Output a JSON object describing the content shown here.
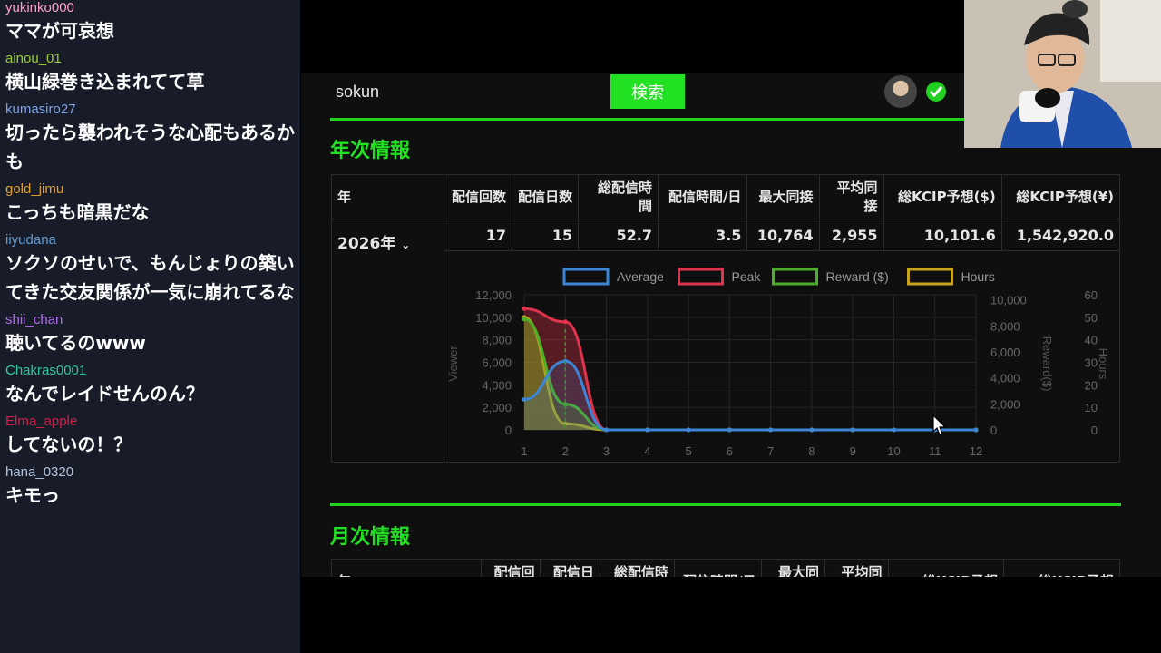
{
  "chat": [
    {
      "user": "yukinko000",
      "color": "#ff9ecf",
      "text": "ママが可哀想"
    },
    {
      "user": "ainou_01",
      "color": "#9acd32",
      "text": "横山緑巻き込まれてて草"
    },
    {
      "user": "kumasiro27",
      "color": "#7ea2e8",
      "text": "切ったら襲われそうな心配もあるかも"
    },
    {
      "user": "gold_jimu",
      "color": "#e0a030",
      "text": "こっちも暗黒だな"
    },
    {
      "user": "iiyudana",
      "color": "#5f9ed8",
      "text": "ソクソのせいで、もんじょりの築いてきた交友関係が一気に崩れてるな"
    },
    {
      "user": "shii_chan",
      "color": "#b070e8",
      "text": "聴いてるのwww"
    },
    {
      "user": "Chakras0001",
      "color": "#2ec7a0",
      "text": "なんでレイドせんのん？"
    },
    {
      "user": "Elma_apple",
      "color": "#d0204a",
      "text": "してないの！？"
    },
    {
      "user": "hana_0320",
      "color": "#b0c4de",
      "text": "キモっ"
    }
  ],
  "topbar": {
    "username": "sokun",
    "search_label": "検索"
  },
  "annual": {
    "title": "年次情報",
    "headers": [
      "年",
      "配信回数",
      "配信日数",
      "総配信時間",
      "配信時間/日",
      "最大同接",
      "平均同接",
      "総KCIP予想($)",
      "総KCIP予想(¥)"
    ],
    "year": "2026年",
    "row": [
      "17",
      "15",
      "52.7",
      "3.5",
      "10,764",
      "2,955",
      "10,101.6",
      "1,542,920.0"
    ]
  },
  "monthly": {
    "title": "月次情報",
    "headers": [
      "年",
      "配信回数",
      "配信日数",
      "総配信時間",
      "配信時間/日",
      "最大同接",
      "平均同接",
      "総KCIP予想",
      "総KCIP予想"
    ]
  },
  "chart_data": {
    "type": "line",
    "x": [
      1,
      2,
      3,
      4,
      5,
      6,
      7,
      8,
      9,
      10,
      11,
      12
    ],
    "legend": [
      "Average",
      "Peak",
      "Reward ($)",
      "Hours"
    ],
    "series": [
      {
        "name": "Average",
        "color": "#3d86d6",
        "axis": "viewer",
        "values": [
          2700,
          6100,
          0,
          0,
          0,
          0,
          0,
          0,
          0,
          0,
          0,
          0
        ]
      },
      {
        "name": "Peak",
        "color": "#e0334d",
        "axis": "viewer",
        "values": [
          10764,
          9600,
          0,
          0,
          0,
          0,
          0,
          0,
          0,
          0,
          0,
          0
        ]
      },
      {
        "name": "Reward ($)",
        "color": "#4caf27",
        "axis": "reward",
        "values": [
          8200,
          1900,
          0,
          0,
          0,
          0,
          0,
          0,
          0,
          0,
          0,
          0
        ]
      },
      {
        "name": "Hours",
        "color": "#c8a51f",
        "axis": "hours",
        "values": [
          50,
          2.7,
          0,
          0,
          0,
          0,
          0,
          0,
          0,
          0,
          0,
          0
        ]
      }
    ],
    "y_left": {
      "label": "Viewer",
      "ticks": [
        "12,000",
        "10,000",
        "8,000",
        "6,000",
        "4,000",
        "2,000",
        "0"
      ],
      "range": [
        0,
        12000
      ]
    },
    "y_right1": {
      "label": "Reward($)",
      "ticks": [
        "10,000",
        "8,000",
        "6,000",
        "4,000",
        "2,000",
        "0"
      ],
      "range": [
        0,
        10000
      ]
    },
    "y_right2": {
      "label": "Hours",
      "ticks": [
        "60",
        "50",
        "40",
        "30",
        "20",
        "10",
        "0"
      ],
      "range": [
        0,
        60
      ]
    },
    "grid": true,
    "legend_position": "top"
  }
}
